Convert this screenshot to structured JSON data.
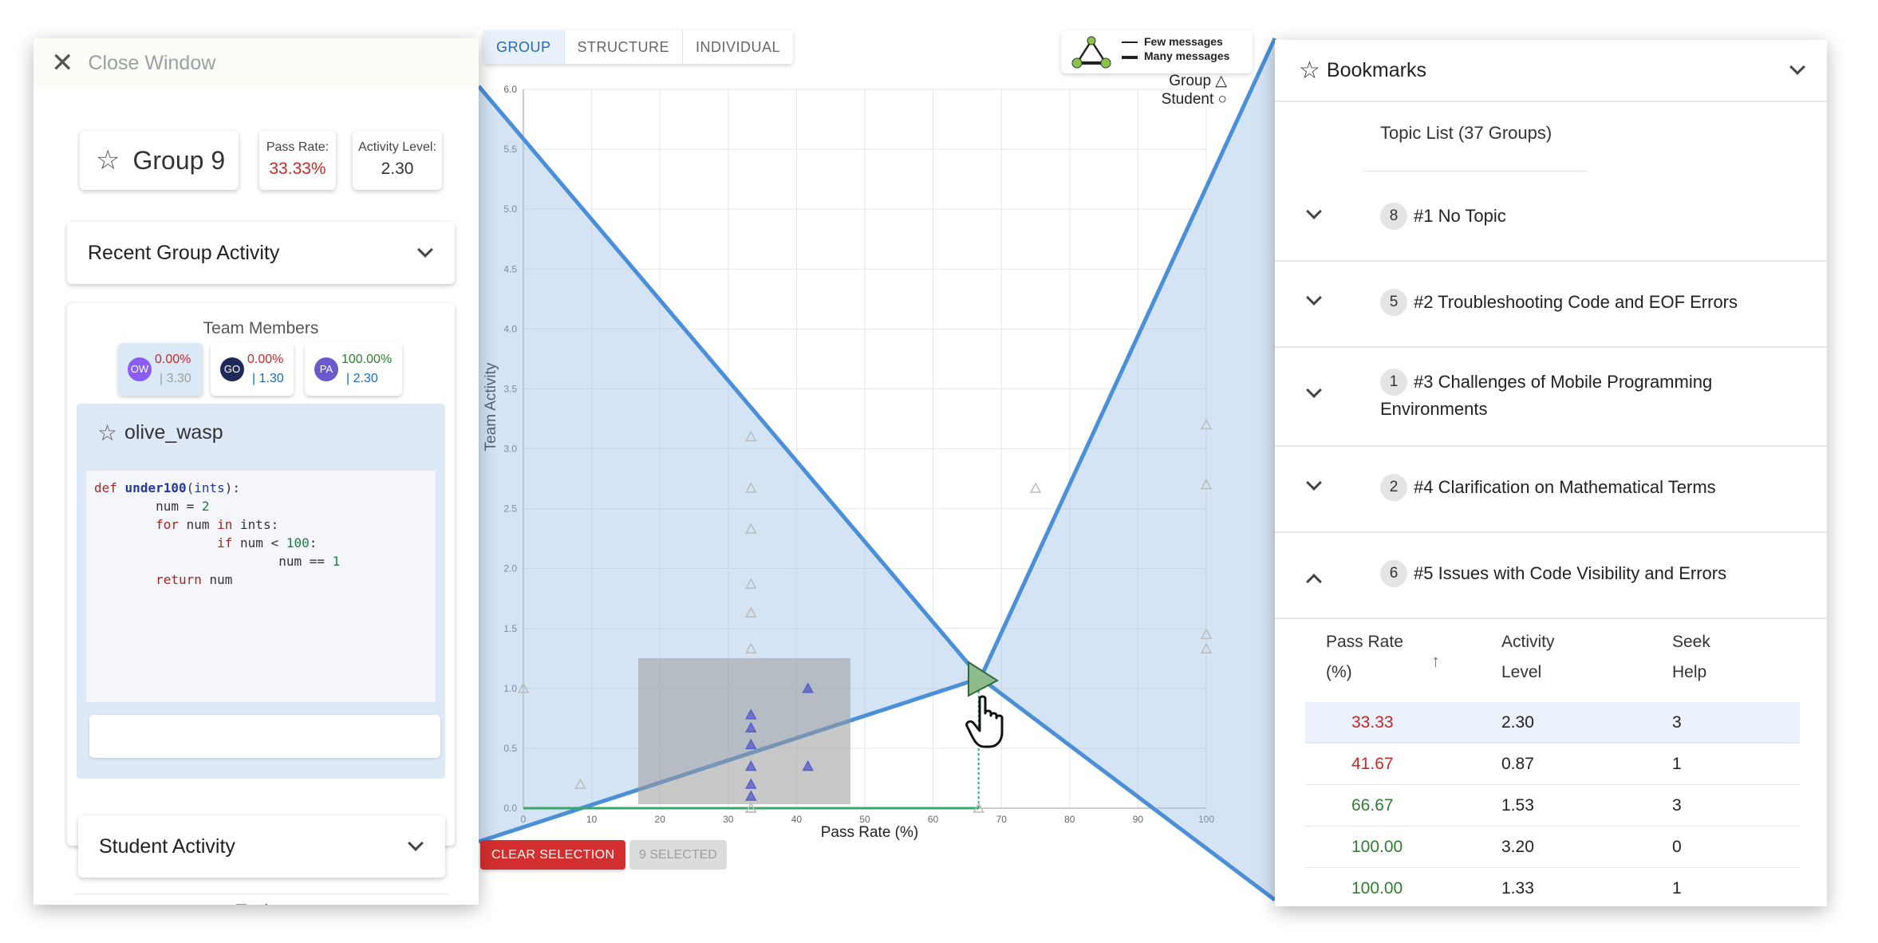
{
  "chart": {
    "tabs": [
      {
        "label": "GROUP",
        "active": true
      },
      {
        "label": "STRUCTURE",
        "active": false
      },
      {
        "label": "INDIVIDUAL",
        "active": false
      }
    ],
    "legend": {
      "few": "Few messages",
      "many": "Many messages",
      "group": "Group",
      "student": "Student"
    },
    "xlabel": "Pass Rate (%)",
    "ylabel": "Team Activity",
    "xticks": [
      "0",
      "10",
      "20",
      "30",
      "40",
      "50",
      "60",
      "70",
      "80",
      "90",
      "100"
    ],
    "yticks": [
      "0.0",
      "0.5",
      "1.0",
      "1.5",
      "2.0",
      "2.5",
      "3.0",
      "3.5",
      "4.0",
      "4.5",
      "5.0",
      "5.5",
      "6.0"
    ],
    "clear_label": "CLEAR SELECTION",
    "selected_label": "9 SELECTED",
    "colors": {
      "accent": "#1e6bbf",
      "selected_marker": "#8fbc8f",
      "clear": "#d32f2f"
    }
  },
  "chart_data": {
    "type": "scatter",
    "xlabel": "Pass Rate (%)",
    "ylabel": "Team Activity",
    "xlim": [
      0,
      100
    ],
    "ylim": [
      0,
      6
    ],
    "grid": true,
    "series": [
      {
        "name": "Group",
        "x": [
          0,
          8.33,
          33.33,
          33.33,
          33.33,
          33.33,
          33.33,
          33.33,
          33.33,
          33.33,
          33.33,
          33.33,
          33.33,
          33.33,
          33.33,
          33.33,
          41.67,
          41.67,
          66.67,
          75,
          100,
          100,
          100,
          100
        ],
        "y": [
          1.0,
          0.2,
          3.1,
          2.67,
          2.33,
          1.87,
          1.63,
          1.33,
          0.78,
          0.67,
          0.53,
          0.35,
          0.2,
          0.1,
          0.0,
          0.0,
          1.0,
          0.35,
          0.0,
          2.67,
          3.2,
          2.7,
          1.45,
          1.33
        ]
      }
    ],
    "selected_point": {
      "x": 66.67,
      "y": 1.1
    }
  },
  "left": {
    "close_label": "Close Window",
    "group_name": "Group 9",
    "pass_rate_label": "Pass Rate:",
    "pass_rate_value": "33.33%",
    "activity_label": "Activity Level:",
    "activity_value": "2.30",
    "recent_activity": "Recent Group Activity",
    "team_members_title": "Team Members",
    "members": [
      {
        "initials": "OW",
        "pass": "0.00%",
        "activity": "| 3.30",
        "color": "#8b5cf6",
        "pass_color": "#c62828",
        "selected": true
      },
      {
        "initials": "GO",
        "pass": "0.00%",
        "activity": "| 1.30",
        "color": "#1f2a5a",
        "pass_color": "#c62828",
        "selected": false
      },
      {
        "initials": "PA",
        "pass": "100.00%",
        "activity": "| 2.30",
        "color": "#6a5acd",
        "pass_color": "#2e7d32",
        "selected": false
      }
    ],
    "student_name": "olive_wasp",
    "student_activity": "Student Activity",
    "footer_peek": "Topics"
  },
  "right": {
    "title": "Bookmarks",
    "topic_list": "Topic List (37 Groups)",
    "topics": [
      {
        "count": "8",
        "label": "#1 No Topic",
        "expanded": false
      },
      {
        "count": "5",
        "label": "#2 Troubleshooting Code and EOF Errors",
        "expanded": false
      },
      {
        "count": "1",
        "label": "#3 Challenges of Mobile Programming Environments",
        "expanded": false
      },
      {
        "count": "2",
        "label": "#4 Clarification on Mathematical Terms",
        "expanded": false
      },
      {
        "count": "6",
        "label": "#5 Issues with Code Visibility and Errors",
        "expanded": true
      }
    ],
    "table": {
      "headers": [
        "Pass Rate (%)",
        "Activity Level",
        "Seek Help"
      ],
      "rows": [
        {
          "pass": "33.33",
          "activity": "2.30",
          "help": "3",
          "color": "#c62828",
          "highlight": true
        },
        {
          "pass": "41.67",
          "activity": "0.87",
          "help": "1",
          "color": "#c62828",
          "highlight": false
        },
        {
          "pass": "66.67",
          "activity": "1.53",
          "help": "3",
          "color": "#2e7d32",
          "highlight": false
        },
        {
          "pass": "100.00",
          "activity": "3.20",
          "help": "0",
          "color": "#2e7d32",
          "highlight": false
        },
        {
          "pass": "100.00",
          "activity": "1.33",
          "help": "1",
          "color": "#2e7d32",
          "highlight": false
        }
      ]
    }
  }
}
